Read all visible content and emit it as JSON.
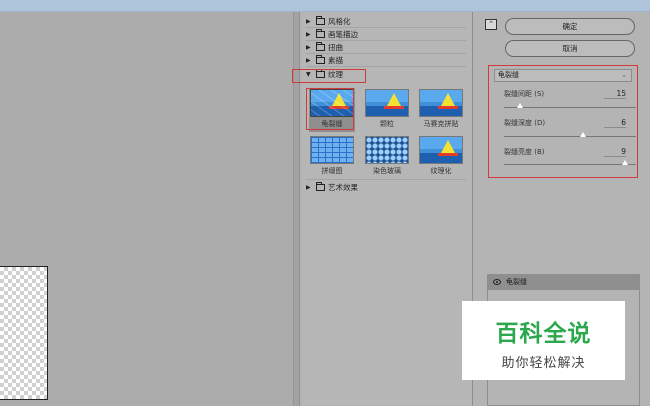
{
  "filter_panel": {
    "categories": [
      {
        "label": "风格化",
        "expanded": false
      },
      {
        "label": "画笔描边",
        "expanded": false
      },
      {
        "label": "扭曲",
        "expanded": false
      },
      {
        "label": "素描",
        "expanded": false
      },
      {
        "label": "纹理",
        "expanded": true
      },
      {
        "label": "艺术效果",
        "expanded": false
      }
    ],
    "texture_filters": [
      {
        "label": "龟裂缝",
        "selected": true
      },
      {
        "label": "颗粒",
        "selected": false
      },
      {
        "label": "马赛克拼贴",
        "selected": false
      },
      {
        "label": "拼缀图",
        "selected": false
      },
      {
        "label": "染色玻璃",
        "selected": false
      },
      {
        "label": "纹理化",
        "selected": false
      }
    ]
  },
  "settings": {
    "collapse_icon": "chevron-up-icon",
    "ok_label": "确定",
    "cancel_label": "取消",
    "filter_select": "龟裂缝",
    "params": [
      {
        "label": "裂缝间距 (S)",
        "value": "15",
        "fraction": 0.12
      },
      {
        "label": "裂缝深度 (D)",
        "value": "6",
        "fraction": 0.6
      },
      {
        "label": "裂缝亮度 (B)",
        "value": "9",
        "fraction": 0.92
      }
    ]
  },
  "layers": {
    "active_layer": "龟裂缝",
    "visibility_icon": "eye-icon"
  },
  "watermark": {
    "title": "百科全说",
    "subtitle": "助你轻松解决"
  },
  "colors": {
    "highlight_red": "#d23a3a",
    "watermark_green": "#2aa84b"
  }
}
